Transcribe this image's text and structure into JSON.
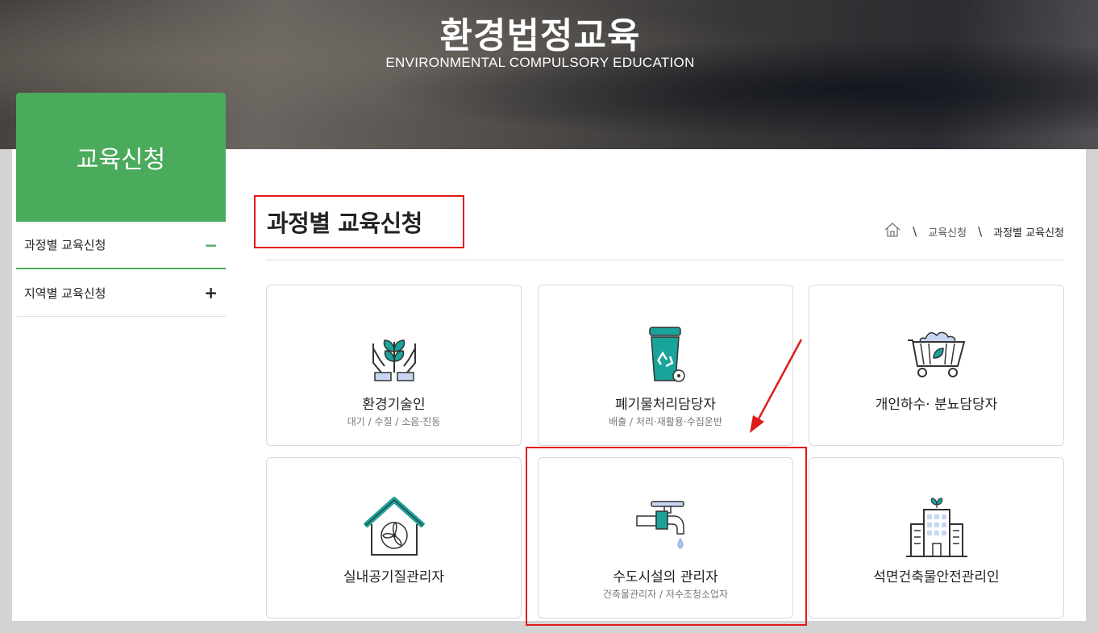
{
  "banner": {
    "title": "환경법정교육",
    "subtitle": "ENVIRONMENTAL COMPULSORY EDUCATION"
  },
  "sidebar": {
    "heading": "교육신청",
    "items": [
      {
        "label": "과정별 교육신청",
        "sign": "−"
      },
      {
        "label": "지역별 교육신청",
        "sign": "+"
      }
    ]
  },
  "page": {
    "title": "과정별 교육신청"
  },
  "breadcrumb": {
    "home_icon": "home-icon",
    "sep": "\\",
    "level1": "교육신청",
    "current": "과정별 교육신청"
  },
  "cards": [
    {
      "name": "환경기술인",
      "desc": "대기 / 수질 / 소음·진동",
      "icon": "hands-plant-icon"
    },
    {
      "name": "폐기물처리담당자",
      "desc": "배출 / 처리·재활용·수집운반",
      "icon": "recycle-bin-icon"
    },
    {
      "name": "개인하수· 분뇨담당자",
      "desc": "",
      "icon": "cart-icon"
    },
    {
      "name": "실내공기질관리자",
      "desc": "",
      "icon": "house-fan-icon"
    },
    {
      "name": "수도시설의 관리자",
      "desc": "건축물관리자 / 저수조청소업자",
      "icon": "faucet-icon"
    },
    {
      "name": "석면건축물안전관리인",
      "desc": "",
      "icon": "building-plant-icon"
    }
  ],
  "colors": {
    "accent_green": "#4bab5d",
    "teal": "#1aa39a",
    "annotation_red": "#e01a1a"
  }
}
